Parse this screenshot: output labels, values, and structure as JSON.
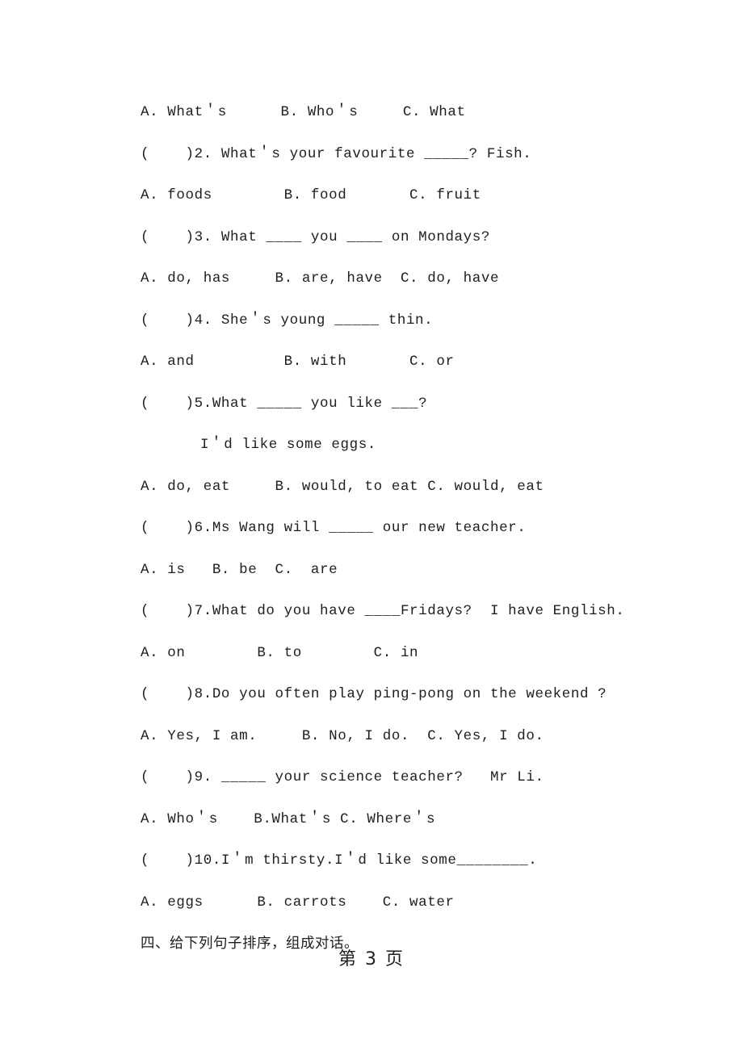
{
  "document": {
    "page_label": "第 3 页",
    "page_number": "3",
    "text_color": "#211d1e",
    "background_color": "#ffffff"
  },
  "lines": [
    {
      "id": "q1-options",
      "text": "A. What＇s      B. Who＇s     C. What"
    },
    {
      "id": "q2-stem",
      "text": "(    )2. What＇s your favourite _____? Fish."
    },
    {
      "id": "q2-options",
      "text": "A. foods        B. food       C. fruit"
    },
    {
      "id": "q3-stem",
      "text": "(    )3. What ____ you ____ on Mondays?"
    },
    {
      "id": "q3-options",
      "text": "A. do, has     B. are, have  C. do, have"
    },
    {
      "id": "q4-stem",
      "text": "(    )4. She＇s young _____ thin."
    },
    {
      "id": "q4-options",
      "text": "A. and          B. with       C. or"
    },
    {
      "id": "q5-stem",
      "text": "(    )5.What _____ you like ___?"
    },
    {
      "id": "q5-stem-2",
      "text": "I＇d like some eggs."
    },
    {
      "id": "q5-options",
      "text": "A. do, eat     B. would, to eat C. would, eat"
    },
    {
      "id": "q6-stem",
      "text": "(    )6.Ms Wang will _____ our new teacher."
    },
    {
      "id": "q6-options",
      "text": "A. is   B. be  C.  are"
    },
    {
      "id": "q7-stem",
      "text": "(    )7.What do you have ____Fridays?  I have English."
    },
    {
      "id": "q7-options",
      "text": "A. on        B. to        C. in"
    },
    {
      "id": "q8-stem",
      "text": "(    )8.Do you often play ping-pong on the weekend ?"
    },
    {
      "id": "q8-options",
      "text": "A. Yes, I am.     B. No, I do.  C. Yes, I do."
    },
    {
      "id": "q9-stem",
      "text": "(    )9. _____ your science teacher?   Mr Li."
    },
    {
      "id": "q9-options",
      "text": "A. Who＇s    B.What＇s C. Where＇s"
    },
    {
      "id": "q10-stem",
      "text": "(    )10.I＇m thirsty.I＇d like some________."
    },
    {
      "id": "q10-options",
      "text": "A. eggs      B. carrots    C. water"
    },
    {
      "id": "section-4",
      "text": "四、给下列句子排序，组成对话。"
    }
  ]
}
